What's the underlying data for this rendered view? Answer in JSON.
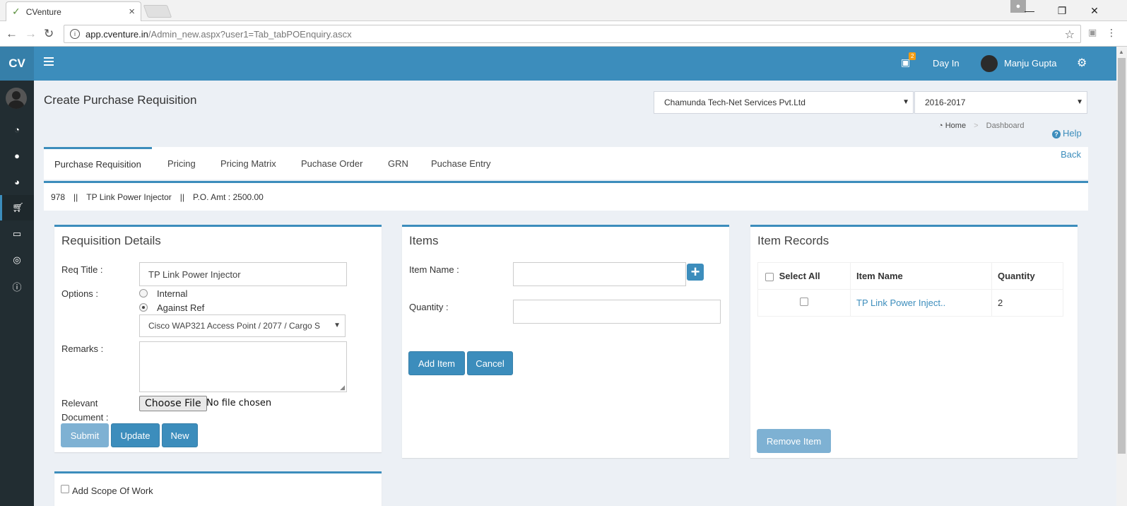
{
  "browser": {
    "tab_title": "CVenture",
    "url_host": "app.cventure.in",
    "url_path": "/Admin_new.aspx?user1=Tab_tabPOEnquiry.ascx"
  },
  "header": {
    "logo": "CV",
    "notif_count": "2",
    "day_in": "Day In",
    "user_name": "Manju Gupta"
  },
  "page": {
    "title": "Create Purchase Requisition",
    "company": "Chamunda Tech-Net Services Pvt.Ltd",
    "year": "2016-2017",
    "breadcrumb_home": "Home",
    "breadcrumb_current": "Dashboard",
    "help": "Help",
    "back": "Back"
  },
  "tabs": [
    "Purchase Requisition",
    "Pricing",
    "Pricing Matrix",
    "Puchase Order",
    "GRN",
    "Puchase Entry"
  ],
  "infobar": {
    "id": "978",
    "sep": "||",
    "item": "TP Link Power Injector",
    "amount": "P.O. Amt : 2500.00"
  },
  "requisition": {
    "title": "Requisition Details",
    "req_title_label": "Req Title :",
    "req_title_value": "TP Link Power Injector",
    "options_label": "Options :",
    "option_internal": "Internal",
    "option_against_ref": "Against Ref",
    "ref_select": "Cisco WAP321 Access Point / 2077 / Cargo S",
    "remarks_label": "Remarks :",
    "relevant_label_1": "Relevant",
    "relevant_label_2": "Document :",
    "choose_file": "Choose File",
    "no_file": "No file chosen",
    "submit": "Submit",
    "update": "Update",
    "new": "New"
  },
  "items": {
    "title": "Items",
    "item_name_label": "Item Name :",
    "quantity_label": "Quantity :",
    "add_item": "Add Item",
    "cancel": "Cancel"
  },
  "records": {
    "title": "Item Records",
    "select_all": "Select All",
    "col_item_name": "Item Name",
    "col_quantity": "Quantity",
    "rows": [
      {
        "item_name": "TP Link Power Inject..",
        "quantity": "2"
      }
    ],
    "remove_item": "Remove Item"
  },
  "scope": {
    "label": "Add Scope Of Work"
  }
}
